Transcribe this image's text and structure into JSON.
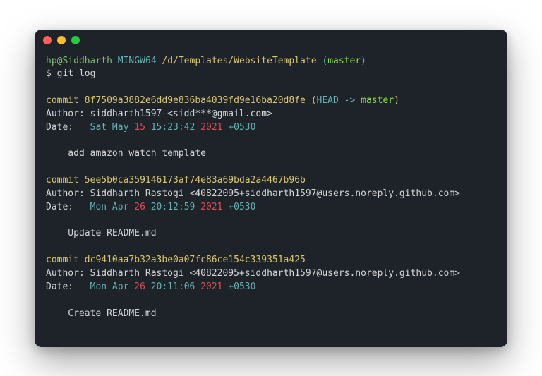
{
  "prompt": {
    "user_host": "hp@Siddharth",
    "sys": "MINGW64",
    "path": "/d/Templates/WebsiteTemplate",
    "branch_open": "(",
    "branch": "master",
    "branch_close": ")",
    "ps1": "$ ",
    "command": "git log"
  },
  "commits": [
    {
      "commit_label": "commit ",
      "hash": "8f7509a3882e6dd9e836ba4039fd9e16ba20d8fe",
      "deco_open": " (",
      "head": "HEAD -> ",
      "branch": "master",
      "deco_close": ")",
      "author_line": "Author: siddharth1597 <sidd***@gmail.com>",
      "date_prefix": "Date:   ",
      "date_day": "Sat May ",
      "date_num": "15",
      "date_time": " 15:23:42 ",
      "date_year": "2021",
      "date_tz": " +0530",
      "message": "    add amazon watch template"
    },
    {
      "commit_label": "commit ",
      "hash": "5ee5b0ca359146173af74e83a69bda2a4467b96b",
      "author_line": "Author: Siddharth Rastogi <40822095+siddharth1597@users.noreply.github.com>",
      "date_prefix": "Date:   ",
      "date_day": "Mon Apr ",
      "date_num": "26",
      "date_time": " 20:12:59 ",
      "date_year": "2021",
      "date_tz": " +0530",
      "message": "    Update README.md"
    },
    {
      "commit_label": "commit ",
      "hash": "dc9410aa7b32a3be0a07fc86ce154c339351a425",
      "author_line": "Author: Siddharth Rastogi <40822095+siddharth1597@users.noreply.github.com>",
      "date_prefix": "Date:   ",
      "date_day": "Mon Apr ",
      "date_num": "26",
      "date_time": " 20:11:06 ",
      "date_year": "2021",
      "date_tz": " +0530",
      "message": "    Create README.md"
    }
  ]
}
